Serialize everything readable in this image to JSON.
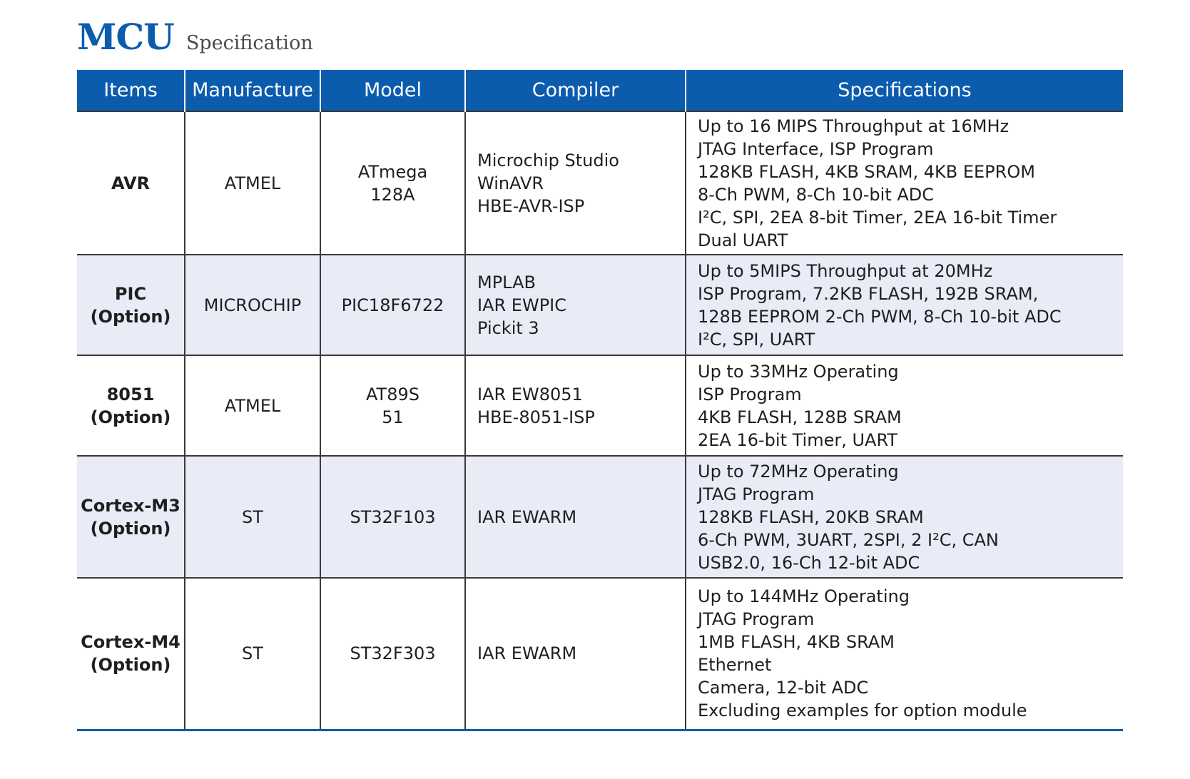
{
  "title": {
    "main": "MCU",
    "sub": "Specification"
  },
  "headers": {
    "items": "Items",
    "manufacture": "Manufacture",
    "model": "Model",
    "compiler": "Compiler",
    "specifications": "Specifications"
  },
  "rows": [
    {
      "item": [
        "AVR"
      ],
      "manufacture": "ATMEL",
      "model": [
        "ATmega",
        "128A"
      ],
      "compiler": [
        "Microchip Studio",
        "WinAVR",
        "HBE-AVR-ISP"
      ],
      "specs": [
        "Up to 16 MIPS Throughput at 16MHz",
        "JTAG Interface, ISP Program",
        "128KB FLASH, 4KB SRAM, 4KB EEPROM",
        "8-Ch PWM, 8-Ch 10-bit ADC",
        "I²C, SPI, 2EA 8-bit Timer, 2EA 16-bit Timer",
        "Dual UART"
      ]
    },
    {
      "item": [
        "PIC",
        "(Option)"
      ],
      "manufacture": "MICROCHIP",
      "model": [
        "PIC18F6722"
      ],
      "compiler": [
        "MPLAB",
        "IAR EWPIC",
        "Pickit 3"
      ],
      "specs": [
        "Up to 5MIPS Throughput at 20MHz",
        "ISP Program, 7.2KB FLASH, 192B SRAM,",
        "128B EEPROM 2-Ch PWM, 8-Ch 10-bit ADC",
        "I²C, SPI, UART"
      ]
    },
    {
      "item": [
        "8051",
        "(Option)"
      ],
      "manufacture": "ATMEL",
      "model": [
        "AT89S",
        "51"
      ],
      "compiler": [
        "IAR EW8051",
        "HBE-8051-ISP"
      ],
      "specs": [
        "Up to 33MHz Operating",
        "ISP Program",
        "4KB FLASH, 128B SRAM",
        "2EA 16-bit Timer, UART"
      ]
    },
    {
      "item": [
        "Cortex-M3",
        "(Option)"
      ],
      "manufacture": "ST",
      "model": [
        "ST32F103"
      ],
      "compiler": [
        "IAR EWARM"
      ],
      "specs": [
        "Up to 72MHz Operating",
        "JTAG Program",
        "128KB FLASH, 20KB SRAM",
        "6-Ch PWM, 3UART, 2SPI, 2 I²C, CAN",
        "USB2.0, 16-Ch 12-bit ADC"
      ]
    },
    {
      "item": [
        "Cortex-M4",
        "(Option)"
      ],
      "manufacture": "ST",
      "model": [
        "ST32F303"
      ],
      "compiler": [
        "IAR EWARM"
      ],
      "specs": [
        "Up to 144MHz Operating",
        "JTAG Program",
        "1MB FLASH, 4KB SRAM",
        "Ethernet",
        "Camera, 12-bit ADC",
        "Excluding examples for option module"
      ]
    }
  ],
  "colors": {
    "brand": "#0b5cad",
    "row_alt": "#e9ebf7",
    "border": "#3a3a3a"
  }
}
